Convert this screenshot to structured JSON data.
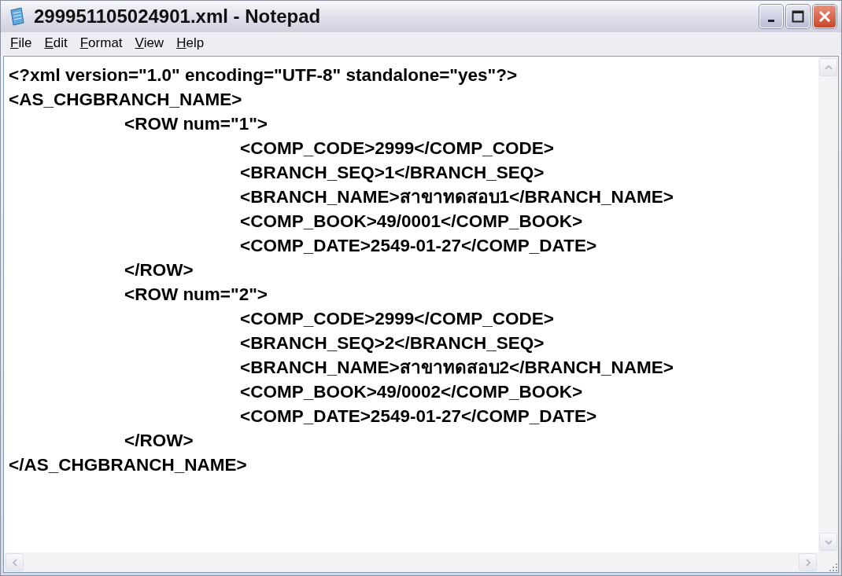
{
  "window": {
    "title": "299951105024901.xml - Notepad"
  },
  "menu": [
    "File",
    "Edit",
    "Format",
    "View",
    "Help"
  ],
  "lines": [
    {
      "text": "<?xml version=\"1.0\" encoding=\"UTF-8\" standalone=\"yes\"?>"
    },
    {
      "text": "<AS_CHGBRANCH_NAME>",
      "children": [
        {
          "text": "<ROW num=\"1\">",
          "children": [
            {
              "text": "<COMP_CODE>2999</COMP_CODE>"
            },
            {
              "text": "<BRANCH_SEQ>1</BRANCH_SEQ>"
            },
            {
              "text": "<BRANCH_NAME>สาขาทดสอบ1</BRANCH_NAME>"
            },
            {
              "text": "<COMP_BOOK>49/0001</COMP_BOOK>"
            },
            {
              "text": "<COMP_DATE>2549-01-27</COMP_DATE>"
            }
          ]
        },
        {
          "text": "</ROW>"
        },
        {
          "text": "<ROW num=\"2\">",
          "children": [
            {
              "text": "<COMP_CODE>2999</COMP_CODE>"
            },
            {
              "text": "<BRANCH_SEQ>2</BRANCH_SEQ>"
            },
            {
              "text": "<BRANCH_NAME>สาขาทดสอบ2</BRANCH_NAME>"
            },
            {
              "text": "<COMP_BOOK>49/0002</COMP_BOOK>"
            },
            {
              "text": "<COMP_DATE>2549-01-27</COMP_DATE>"
            }
          ]
        },
        {
          "text": "</ROW>"
        }
      ]
    },
    {
      "text": "</AS_CHGBRANCH_NAME>"
    }
  ]
}
